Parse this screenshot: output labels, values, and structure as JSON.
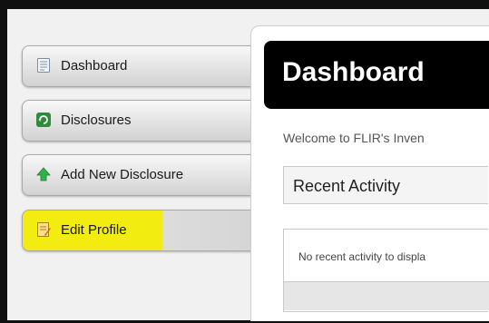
{
  "sidebar": {
    "items": [
      {
        "label": "Dashboard",
        "icon": "document-list-icon"
      },
      {
        "label": "Disclosures",
        "icon": "refresh-icon"
      },
      {
        "label": "Add New Disclosure",
        "icon": "arrow-up-icon"
      },
      {
        "label": "Edit Profile",
        "icon": "edit-note-icon",
        "highlighted": true
      }
    ]
  },
  "main": {
    "title": "Dashboard",
    "welcome": "Welcome to FLIR's Inven",
    "section_title": "Recent Activity",
    "empty_message": "No recent activity to displa"
  },
  "colors": {
    "highlight": "#f2ec10",
    "title_bar": "#000000",
    "frame": "#101010"
  }
}
